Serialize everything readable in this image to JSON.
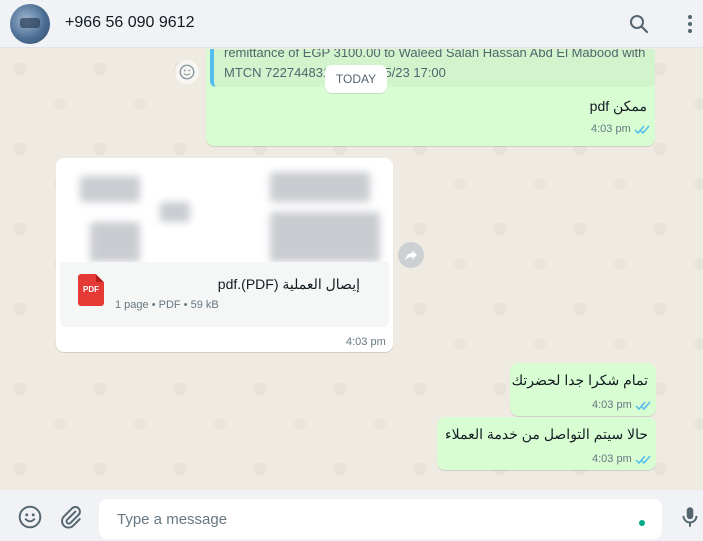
{
  "header": {
    "contact_name": "+966 56 090 9612",
    "search_icon": "search-icon",
    "menu_icon": "kebab-menu-icon"
  },
  "chat": {
    "date_separator": "TODAY",
    "messages": [
      {
        "direction": "outgoing",
        "quoted_lines": [
          "remittance of EGP 3100.00 to Waleed Salah Hassan Abd El Mabood with",
          "MTCN 7227448315 on 14/05/23 17:00"
        ],
        "text": "ممكن pdf",
        "time": "4:03 pm",
        "status": "read"
      },
      {
        "direction": "incoming",
        "type": "document",
        "file_name": "إيصال العملية (PDF).pdf",
        "file_badge": "PDF",
        "file_meta": "1 page • PDF • 59 kB",
        "time": "4:03 pm"
      },
      {
        "direction": "outgoing",
        "text": "تمام شكرا جدا لحضرتك",
        "time": "4:03 pm",
        "status": "read"
      },
      {
        "direction": "outgoing",
        "text": "حالا سيتم التواصل من خدمة العملاء",
        "time": "4:03 pm",
        "status": "read"
      }
    ]
  },
  "footer": {
    "placeholder": "Type a message",
    "emoji_icon": "emoji-icon",
    "attach_icon": "paperclip-icon",
    "mic_icon": "microphone-icon"
  },
  "colors": {
    "outgoing_bubble": "#d9fdd3",
    "incoming_bubble": "#ffffff",
    "chat_background": "#efeae2",
    "read_ticks": "#53bdeb",
    "header_background": "#f0f2f5"
  }
}
